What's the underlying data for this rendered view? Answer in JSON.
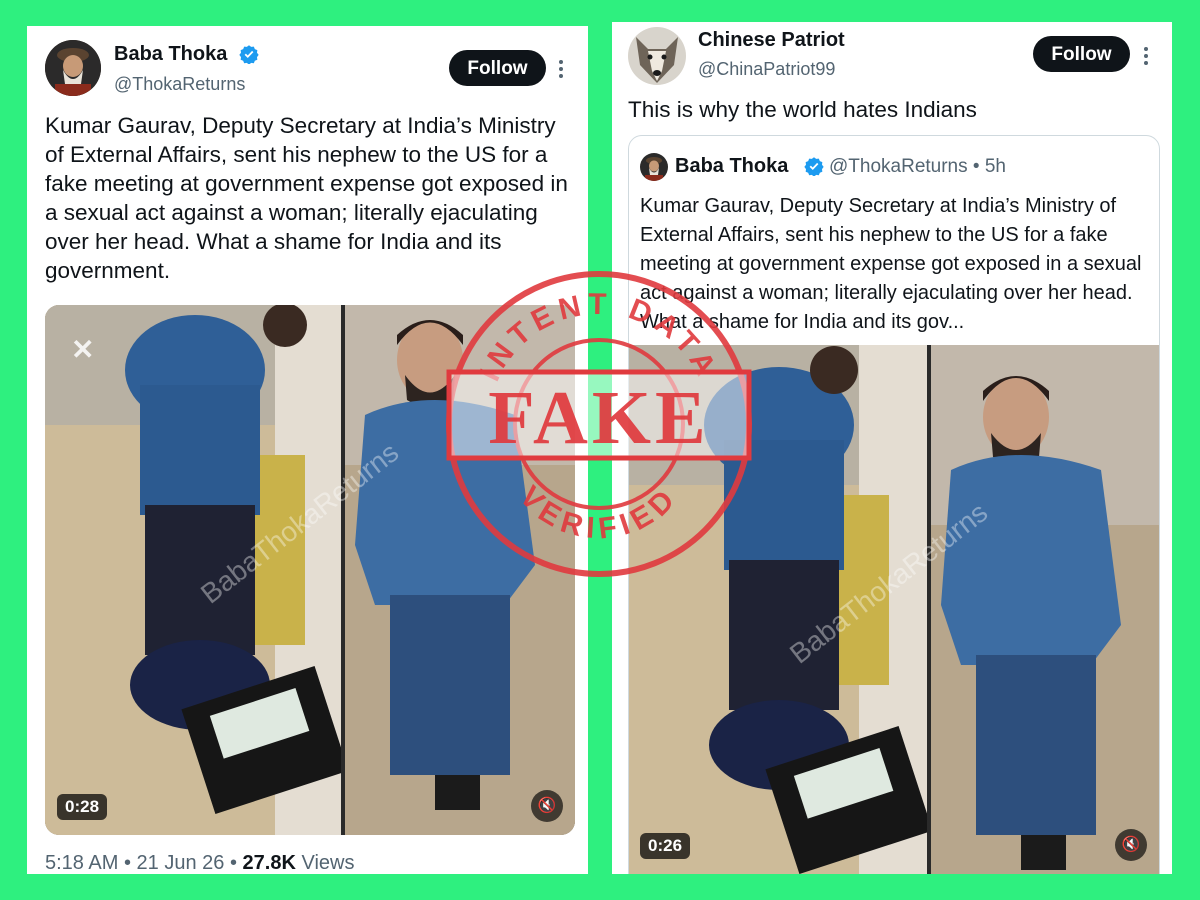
{
  "left_tweet": {
    "display_name": "Baba Thoka",
    "handle": "@ThokaReturns",
    "follow_label": "Follow",
    "text": "Kumar Gaurav, Deputy Secretary at India’s Ministry of External Affairs, sent his nephew to the US for a fake meeting at government expense got exposed in a sexual act against a woman; literally ejaculating over her head. What a shame for India and its government.",
    "video_duration": "0:28",
    "watermark": "BabaThokaReturns",
    "meta": {
      "time": "5:18 AM",
      "sep1": "•",
      "date": "21 Jun 26",
      "sep2": "•",
      "views_count": "27.8K",
      "views_label": "Views"
    }
  },
  "right_tweet": {
    "display_name": "Chinese Patriot",
    "handle": "@ChinaPatriot99",
    "follow_label": "Follow",
    "text": "This is why the world hates Indians",
    "quoted": {
      "display_name": "Baba Thoka",
      "handle": "@ThokaReturns",
      "separator": "•",
      "age": "5h",
      "text": "Kumar Gaurav, Deputy Secretary at India’s Ministry of External Affairs, sent his nephew to the US for a fake meeting at government expense got exposed in a sexual act against a woman; literally ejaculating over her head. What a shame for India and its gov...",
      "video_duration": "0:26",
      "watermark": "BabaThokaReturns"
    }
  },
  "stamp": {
    "top_text": "INTENT DATA",
    "main_text": "FAKE",
    "bottom_text": "VERIFIED"
  },
  "colors": {
    "background": "#2ef07f",
    "verified_blue": "#1d9bf0",
    "stamp_red": "#e03a3e",
    "follow_button": "#0f1419"
  }
}
